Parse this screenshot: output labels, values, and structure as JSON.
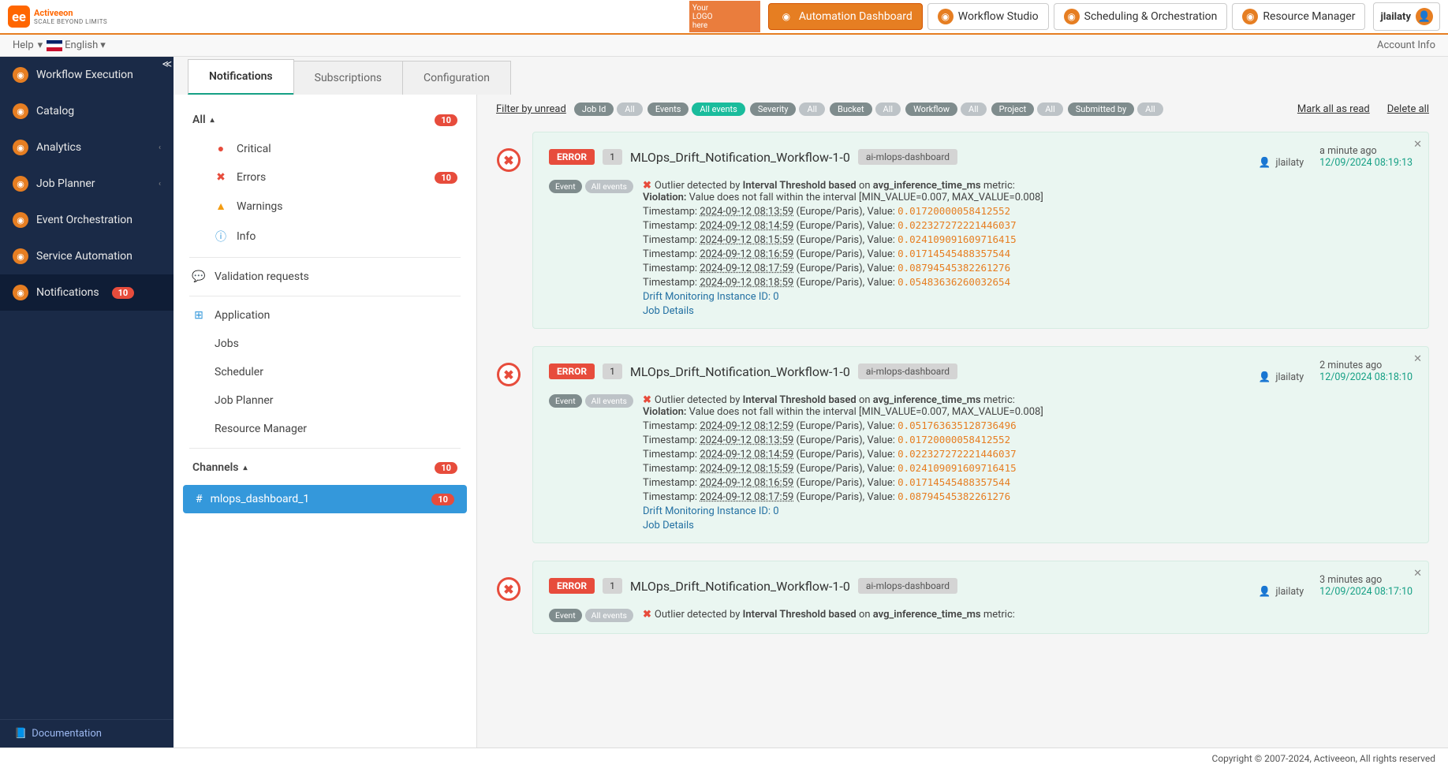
{
  "header": {
    "brand": "Activeeon",
    "brand_sub": "SCALE BEYOND LIMITS",
    "logo_box": "Your\nLOGO\nhere",
    "nav": [
      {
        "label": "Automation Dashboard",
        "active": true
      },
      {
        "label": "Workflow Studio",
        "active": false
      },
      {
        "label": "Scheduling & Orchestration",
        "active": false
      },
      {
        "label": "Resource Manager",
        "active": false
      }
    ],
    "user": "jlailaty"
  },
  "subhead": {
    "help": "Help",
    "language": "English",
    "account": "Account Info"
  },
  "leftnav": [
    {
      "label": "Workflow Execution"
    },
    {
      "label": "Catalog"
    },
    {
      "label": "Analytics",
      "chev": true
    },
    {
      "label": "Job Planner",
      "chev": true
    },
    {
      "label": "Event Orchestration"
    },
    {
      "label": "Service Automation"
    },
    {
      "label": "Notifications",
      "badge": "10",
      "active": true
    }
  ],
  "doc_link": "Documentation",
  "tabs": [
    {
      "label": "Notifications",
      "active": true
    },
    {
      "label": "Subscriptions",
      "active": false
    },
    {
      "label": "Configuration",
      "active": false
    }
  ],
  "filters": {
    "all_label": "All",
    "all_count": "10",
    "severities": [
      {
        "label": "Critical",
        "color": "#e74c3c",
        "icon": "●"
      },
      {
        "label": "Errors",
        "color": "#e74c3c",
        "icon": "✖",
        "count": "10"
      },
      {
        "label": "Warnings",
        "color": "#f39c12",
        "icon": "▲"
      },
      {
        "label": "Info",
        "color": "#3498db",
        "icon": "ⓘ"
      }
    ],
    "validation_label": "Validation requests",
    "application_label": "Application",
    "subs": [
      {
        "label": "Jobs"
      },
      {
        "label": "Scheduler"
      },
      {
        "label": "Job Planner"
      },
      {
        "label": "Resource Manager"
      }
    ],
    "channels_label": "Channels",
    "channels_count": "10",
    "channels": [
      {
        "label": "mlops_dashboard_1",
        "count": "10",
        "active": true
      }
    ]
  },
  "filterbar": {
    "filter_unread": "Filter by unread",
    "groups": [
      {
        "label": "Job Id",
        "opt": "All"
      },
      {
        "label": "Events",
        "opt": "All events",
        "sel": true
      },
      {
        "label": "Severity",
        "opt": "All"
      },
      {
        "label": "Bucket",
        "opt": "All"
      },
      {
        "label": "Workflow",
        "opt": "All"
      },
      {
        "label": "Project",
        "opt": "All"
      },
      {
        "label": "Submitted by",
        "opt": "All"
      }
    ],
    "mark_read": "Mark all as read",
    "delete_all": "Delete all"
  },
  "notifications": [
    {
      "severity": "ERROR",
      "num": "1",
      "workflow": "MLOps_Drift_Notification_Workflow-1-0",
      "tag": "ai-mlops-dashboard",
      "user": "jlailaty",
      "rel_time": "a minute ago",
      "abs_time": "12/09/2024 08:19:13",
      "evt_label": "Event",
      "evt_opt": "All events",
      "outlier_pre": "Outlier detected by ",
      "outlier_method": "Interval Threshold based",
      "outlier_on": " on ",
      "outlier_metric": "avg_inference_time_ms",
      "outlier_post": " metric:",
      "violation_label": "Violation:",
      "violation_text": " Value does not fall within the interval [MIN_VALUE=0.007, MAX_VALUE=0.008]",
      "rows": [
        {
          "ts": "2024-09-12 08:13:59",
          "val": "0.01720000058412552"
        },
        {
          "ts": "2024-09-12 08:14:59",
          "val": "0.022327272221446037"
        },
        {
          "ts": "2024-09-12 08:15:59",
          "val": "0.024109091609716415"
        },
        {
          "ts": "2024-09-12 08:16:59",
          "val": "0.01714545488357544"
        },
        {
          "ts": "2024-09-12 08:17:59",
          "val": "0.08794545382261276"
        },
        {
          "ts": "2024-09-12 08:18:59",
          "val": "0.05483636260032654"
        }
      ],
      "instance_label": "Drift Monitoring Instance ID: 0",
      "job_details": "Job Details"
    },
    {
      "severity": "ERROR",
      "num": "1",
      "workflow": "MLOps_Drift_Notification_Workflow-1-0",
      "tag": "ai-mlops-dashboard",
      "user": "jlailaty",
      "rel_time": "2 minutes ago",
      "abs_time": "12/09/2024 08:18:10",
      "evt_label": "Event",
      "evt_opt": "All events",
      "outlier_pre": "Outlier detected by ",
      "outlier_method": "Interval Threshold based",
      "outlier_on": " on ",
      "outlier_metric": "avg_inference_time_ms",
      "outlier_post": " metric:",
      "violation_label": "Violation:",
      "violation_text": " Value does not fall within the interval [MIN_VALUE=0.007, MAX_VALUE=0.008]",
      "rows": [
        {
          "ts": "2024-09-12 08:12:59",
          "val": "0.051763635128736496"
        },
        {
          "ts": "2024-09-12 08:13:59",
          "val": "0.01720000058412552"
        },
        {
          "ts": "2024-09-12 08:14:59",
          "val": "0.022327272221446037"
        },
        {
          "ts": "2024-09-12 08:15:59",
          "val": "0.024109091609716415"
        },
        {
          "ts": "2024-09-12 08:16:59",
          "val": "0.01714545488357544"
        },
        {
          "ts": "2024-09-12 08:17:59",
          "val": "0.08794545382261276"
        }
      ],
      "instance_label": "Drift Monitoring Instance ID: 0",
      "job_details": "Job Details"
    },
    {
      "severity": "ERROR",
      "num": "1",
      "workflow": "MLOps_Drift_Notification_Workflow-1-0",
      "tag": "ai-mlops-dashboard",
      "user": "jlailaty",
      "rel_time": "3 minutes ago",
      "abs_time": "12/09/2024 08:17:10",
      "evt_label": "Event",
      "evt_opt": "All events",
      "outlier_pre": "Outlier detected by ",
      "outlier_method": "Interval Threshold based",
      "outlier_on": " on ",
      "outlier_metric": "avg_inference_time_ms",
      "outlier_post": " metric:",
      "violation_label": "",
      "violation_text": "",
      "rows": [],
      "instance_label": "",
      "job_details": ""
    }
  ],
  "footer": {
    "copyright": "Copyright © 2007-2024, Activeeon, All rights reserved"
  }
}
